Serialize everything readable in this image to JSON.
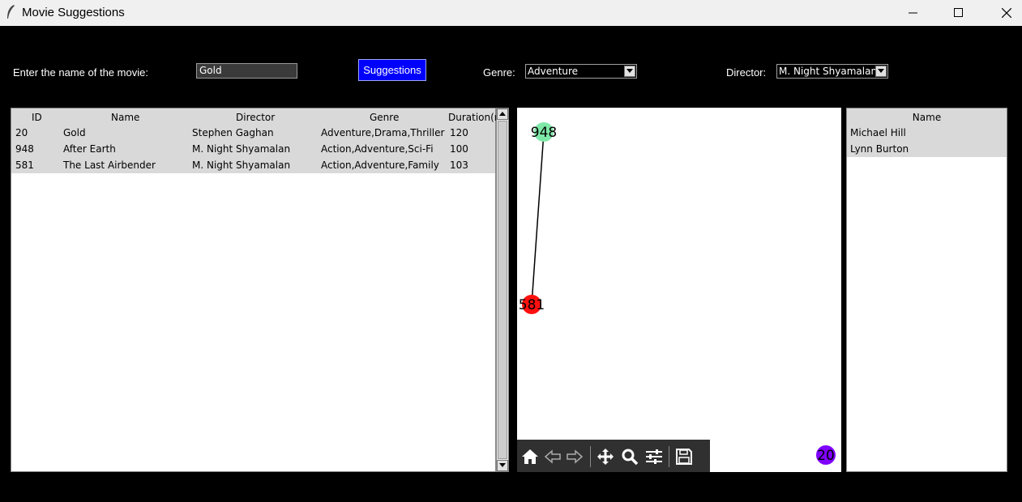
{
  "window": {
    "title": "Movie Suggestions",
    "icon": "feather-icon"
  },
  "controls": {
    "movie_label": "Enter the name of the movie:",
    "movie_value": "Gold",
    "suggest_label": "Suggestions",
    "genre_label": "Genre:",
    "genre_value": "Adventure",
    "director_label": "Director:",
    "director_value": "M. Night Shyamalan"
  },
  "table": {
    "columns": [
      "ID",
      "Name",
      "Director",
      "Genre",
      "Duration(n"
    ],
    "rows": [
      [
        "20",
        "Gold",
        "Stephen Gaghan",
        "Adventure,Drama,Thriller",
        "120"
      ],
      [
        "948",
        "After Earth",
        "M. Night Shyamalan",
        "Action,Adventure,Sci-Fi",
        "100"
      ],
      [
        "581",
        "The Last Airbender",
        "M. Night Shyamalan",
        "Action,Adventure,Family",
        "103"
      ]
    ]
  },
  "graph": {
    "nodes": [
      {
        "label": "948",
        "color": "#7fe8a8"
      },
      {
        "label": "581",
        "color": "#ff1010"
      },
      {
        "label": "20",
        "color": "#7f00ff"
      }
    ],
    "edges": [
      [
        "948",
        "581"
      ]
    ],
    "toolbar": [
      "home-icon",
      "back-arrow-icon",
      "forward-arrow-icon",
      "pan-icon",
      "zoom-icon",
      "configure-subplots-icon",
      "save-icon"
    ]
  },
  "people": {
    "header": "Name",
    "rows": [
      "Michael Hill",
      "Lynn Burton"
    ]
  }
}
